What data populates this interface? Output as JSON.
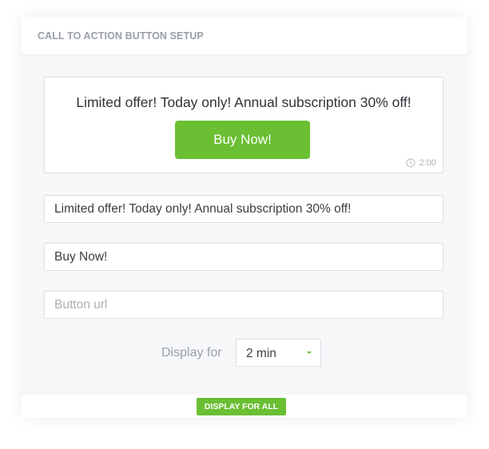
{
  "header": {
    "title": "CALL TO ACTION BUTTON SETUP"
  },
  "preview": {
    "message": "Limited offer! Today only! Annual subscription 30% off!",
    "button_label": "Buy Now!",
    "timer": "2:00",
    "timer_icon": "clock-icon"
  },
  "form": {
    "message_value": "Limited offer! Today only! Annual subscription 30% off!",
    "button_text_value": "Buy Now!",
    "url_placeholder": "Button url",
    "display_for_label": "Display for",
    "display_for_value": "2 min"
  },
  "footer": {
    "button_label": "DISPLAY FOR ALL"
  },
  "colors": {
    "accent": "#6abf33",
    "header_text": "#9aa0a9"
  }
}
